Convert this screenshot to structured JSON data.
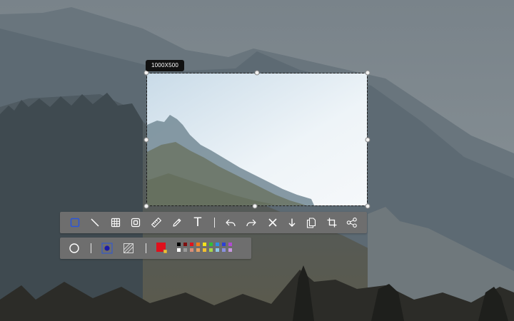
{
  "selection": {
    "size_label": "1000X500"
  },
  "main_toolbar": {
    "tools": [
      {
        "icon": "rectangle-icon",
        "active": true
      },
      {
        "icon": "line-icon"
      },
      {
        "icon": "mosaic-grid-icon"
      },
      {
        "icon": "frame-icon"
      },
      {
        "icon": "ruler-icon"
      },
      {
        "icon": "pencil-icon"
      },
      {
        "icon": "text-icon",
        "label": "T"
      },
      {
        "icon": "undo-icon"
      },
      {
        "icon": "redo-icon"
      },
      {
        "icon": "cancel-icon"
      },
      {
        "icon": "download-icon"
      },
      {
        "icon": "copy-icon"
      },
      {
        "icon": "crop-icon"
      },
      {
        "icon": "share-icon"
      }
    ]
  },
  "sub_toolbar": {
    "options": [
      {
        "icon": "circle-stroke-icon"
      },
      {
        "icon": "filled-dot-icon",
        "active": true
      },
      {
        "icon": "hatch-fill-icon"
      }
    ],
    "current_color": "#e0101c",
    "palette_top": [
      "#000000",
      "#7f1010",
      "#e0141c",
      "#f07c18",
      "#f2e21c",
      "#2fbf3a",
      "#2e8be2",
      "#2b3fd8",
      "#b04ad0"
    ],
    "palette_bottom": [
      "#ffffff",
      "#9a9a9a",
      "#d98e78",
      "#e8a060",
      "#f2c030",
      "#a8d848",
      "#8ec8e8",
      "#8890e0",
      "#c898e0"
    ]
  },
  "colors": {
    "accent": "#2b55d9",
    "toolbar_bg": "#6e6e6e",
    "icon": "#ffffff"
  }
}
